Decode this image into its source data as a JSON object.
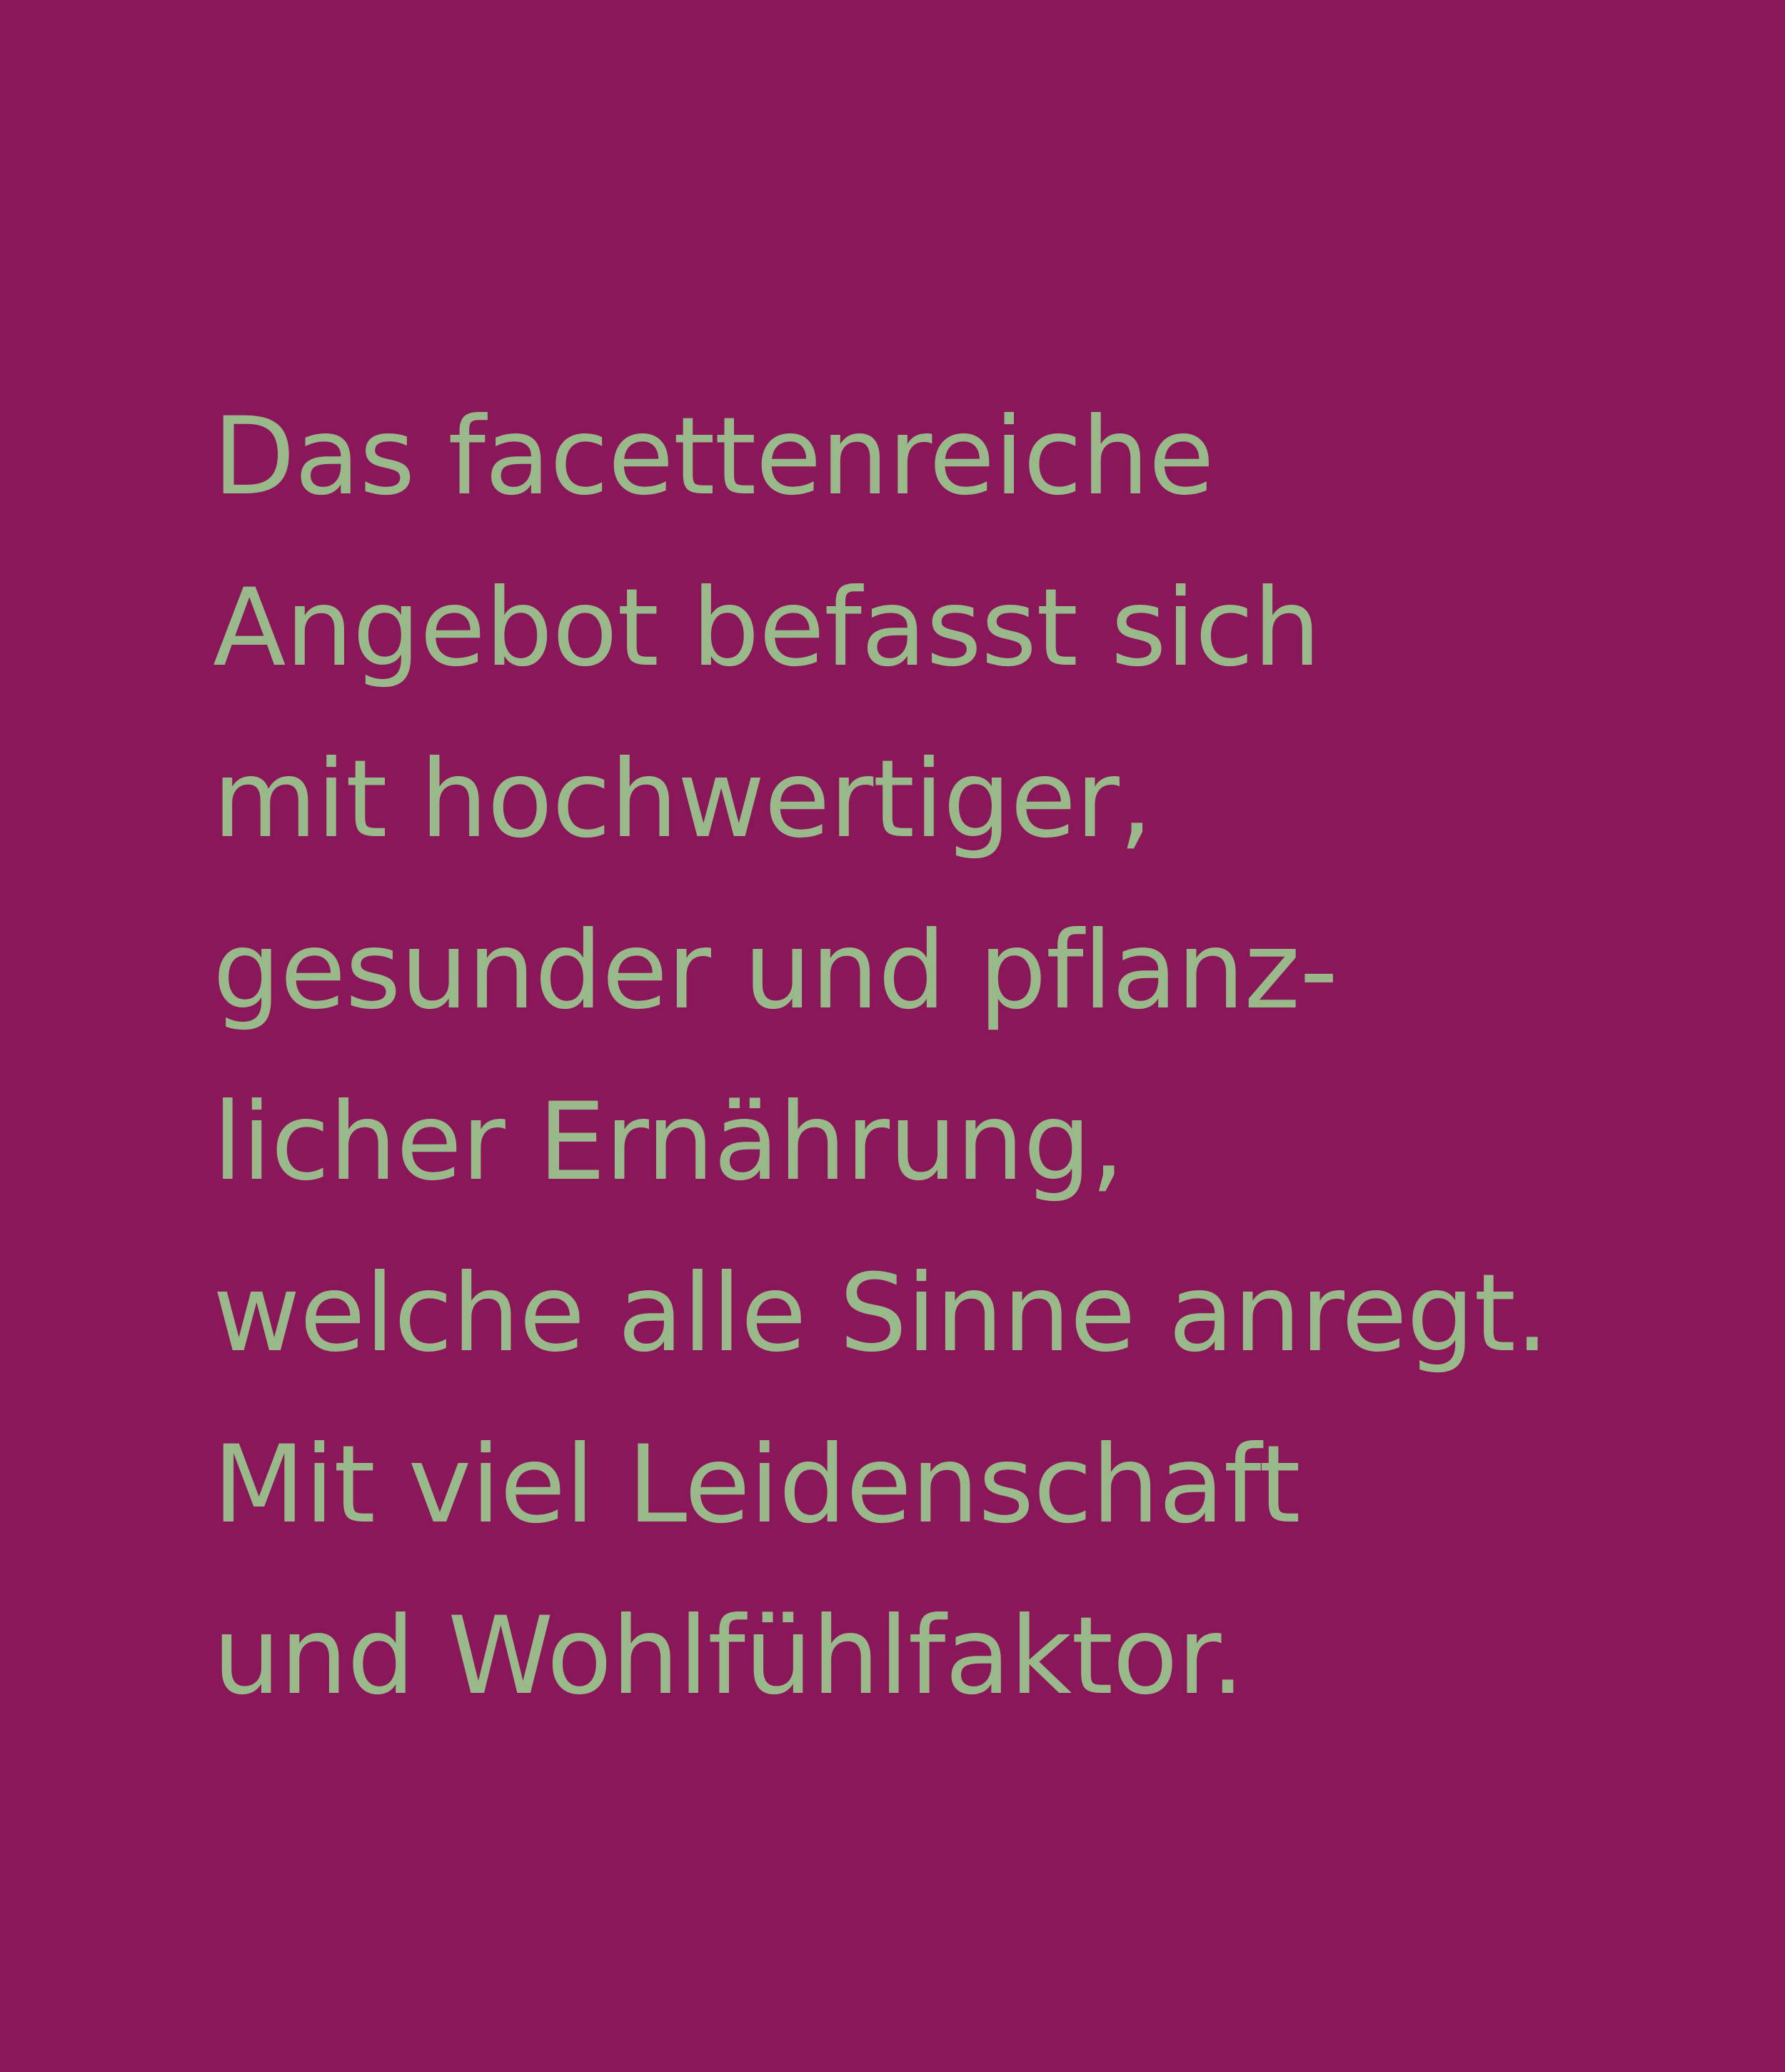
{
  "colors": {
    "background": "#8a1759",
    "text": "#9ab98a"
  },
  "body_text": {
    "lines": [
      "Das facettenreiche",
      "Angebot befasst sich",
      "mit hochwertiger,",
      "gesunder und pflanz-",
      "licher Ernährung,",
      "welche alle Sinne anregt.",
      "Mit viel Leidenschaft",
      "und Wohlfühlfaktor."
    ]
  }
}
